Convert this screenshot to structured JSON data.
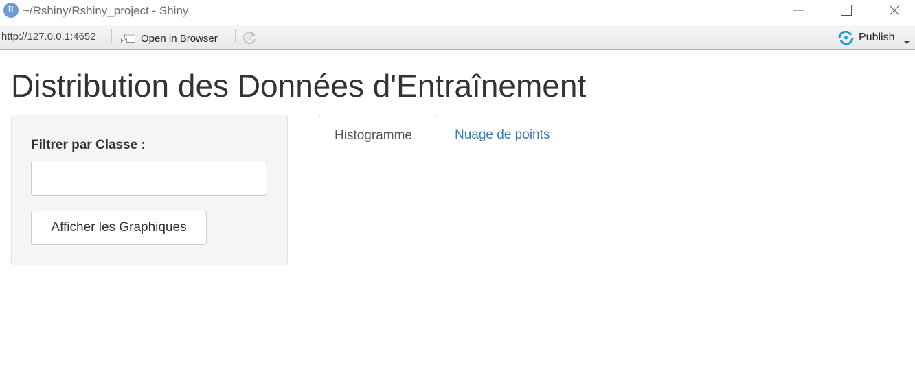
{
  "window": {
    "app_icon_letter": "R",
    "title": "~/Rshiny/Rshiny_project - Shiny"
  },
  "toolbar": {
    "url": "http://127.0.0.1:4652",
    "open_in_browser_label": "Open in Browser",
    "publish_label": "Publish"
  },
  "page": {
    "title": "Distribution des Données d'Entraînement"
  },
  "sidebar": {
    "filter_label": "Filtrer par Classe :",
    "filter_value": "",
    "filter_placeholder": "",
    "show_button_label": "Afficher les Graphiques"
  },
  "tabs": [
    {
      "label": "Histogramme",
      "active": true
    },
    {
      "label": "Nuage de points",
      "active": false
    }
  ],
  "colors": {
    "link": "#337ab7",
    "publish_icon": "#1a9bd7",
    "r_logo": "#6a9bd1"
  },
  "icons": {
    "app": "r-logo-icon",
    "minimize": "minimize-icon",
    "maximize": "maximize-icon",
    "close": "close-icon",
    "open_in_browser": "open-in-browser-icon",
    "refresh": "refresh-icon",
    "publish": "publish-icon",
    "caret": "chevron-down-icon"
  }
}
